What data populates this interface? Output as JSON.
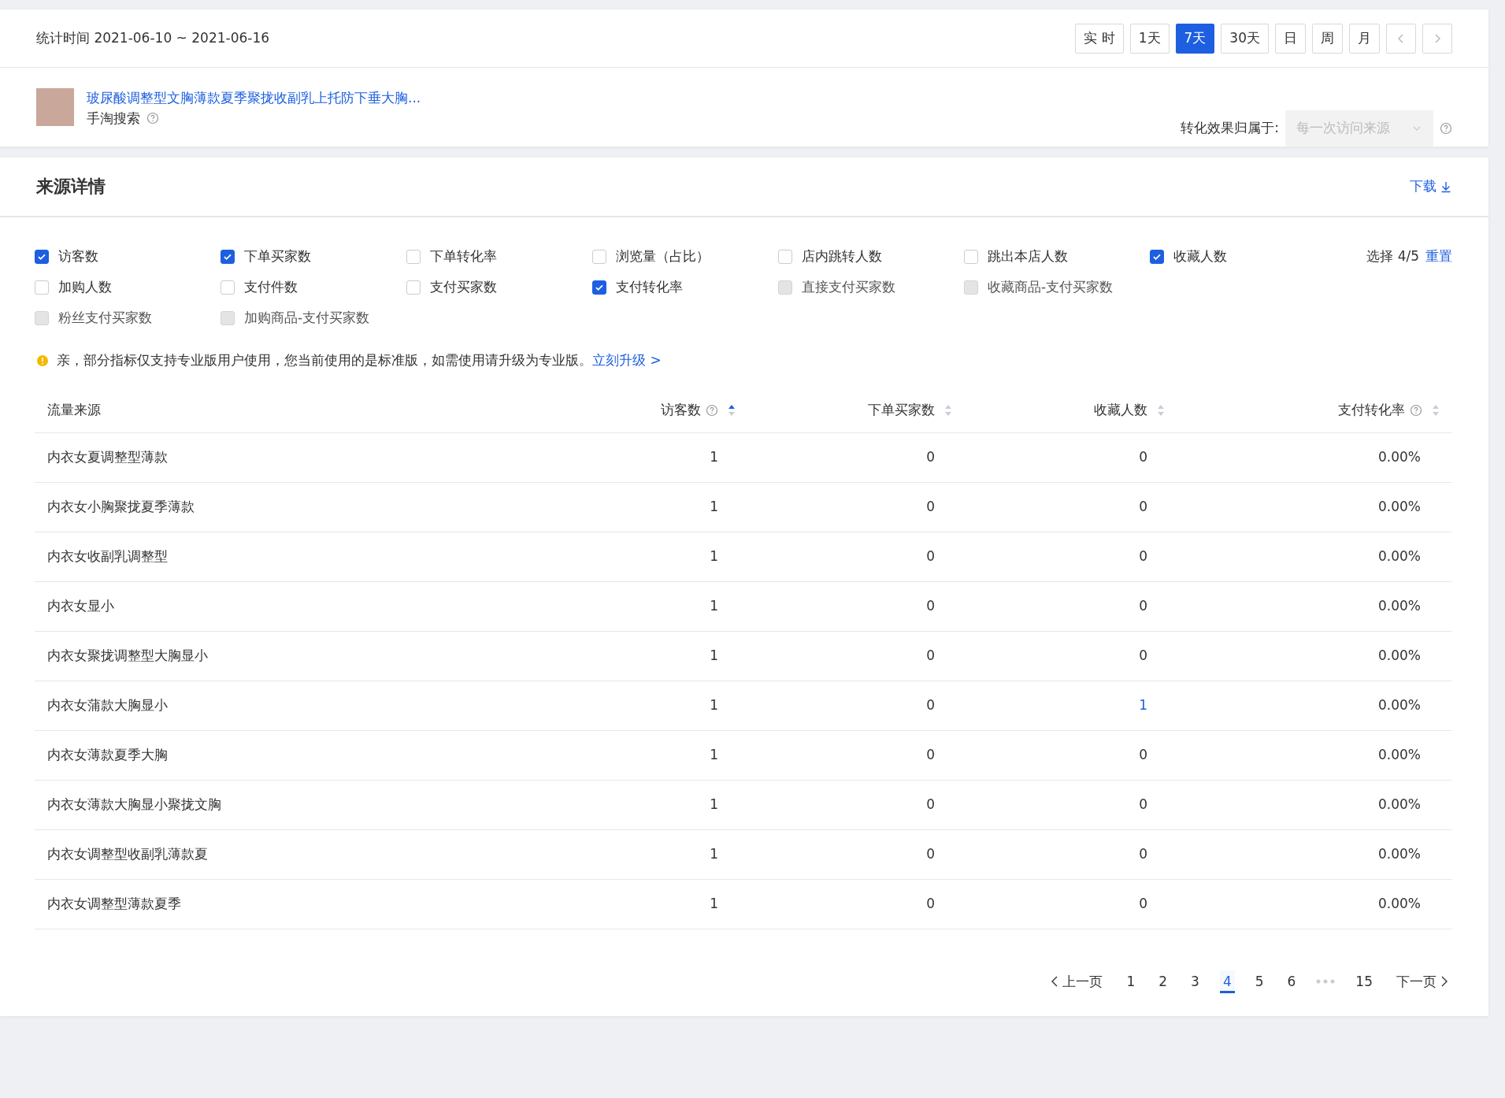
{
  "stats_period": {
    "label": "统计时间 2021-06-10 ~ 2021-06-16"
  },
  "range_buttons": [
    {
      "label": "实 时",
      "selected": false,
      "kind": "text"
    },
    {
      "label": "1天",
      "selected": false,
      "kind": "text"
    },
    {
      "label": "7天",
      "selected": true,
      "kind": "text"
    },
    {
      "label": "30天",
      "selected": false,
      "kind": "text"
    },
    {
      "label": "日",
      "selected": false,
      "kind": "text"
    },
    {
      "label": "周",
      "selected": false,
      "kind": "text"
    },
    {
      "label": "月",
      "selected": false,
      "kind": "text"
    },
    {
      "kind": "prev",
      "selected": false
    },
    {
      "kind": "next",
      "selected": false
    }
  ],
  "product": {
    "title": "玻尿酸调整型文胸薄款夏季聚拢收副乳上托防下垂大胸...",
    "source": "手淘搜索"
  },
  "attribution": {
    "label": "转化效果归属于:",
    "placeholder": "每一次访问来源",
    "disabled": true
  },
  "section": {
    "title": "来源详情",
    "download": "下载"
  },
  "metrics": [
    {
      "label": "访客数",
      "checked": true,
      "disabled": false
    },
    {
      "label": "下单买家数",
      "checked": true,
      "disabled": false
    },
    {
      "label": "下单转化率",
      "checked": false,
      "disabled": false
    },
    {
      "label": "浏览量（占比）",
      "checked": false,
      "disabled": false
    },
    {
      "label": "店内跳转人数",
      "checked": false,
      "disabled": false
    },
    {
      "label": "跳出本店人数",
      "checked": false,
      "disabled": false
    },
    {
      "label": "收藏人数",
      "checked": true,
      "disabled": false
    },
    {
      "label": "加购人数",
      "checked": false,
      "disabled": false
    },
    {
      "label": "支付件数",
      "checked": false,
      "disabled": false
    },
    {
      "label": "支付买家数",
      "checked": false,
      "disabled": false
    },
    {
      "label": "支付转化率",
      "checked": true,
      "disabled": false
    },
    {
      "label": "直接支付买家数",
      "checked": false,
      "disabled": true
    },
    {
      "label": "收藏商品-支付买家数",
      "checked": false,
      "disabled": true
    },
    {
      "label": "粉丝支付买家数",
      "checked": false,
      "disabled": true
    },
    {
      "label": "加购商品-支付买家数",
      "checked": false,
      "disabled": true
    }
  ],
  "selection": {
    "count": "选择 4/5",
    "reset": "重置"
  },
  "notice": {
    "text": "亲，部分指标仅支持专业版用户使用，您当前使用的是标准版，如需使用请升级为专业版。",
    "link": "立刻升级 >"
  },
  "table": {
    "columns": [
      {
        "label": "流量来源",
        "help": false,
        "sortable": false,
        "sorted": false
      },
      {
        "label": "访客数",
        "help": true,
        "sortable": true,
        "sorted": true
      },
      {
        "label": "下单买家数",
        "help": false,
        "sortable": true,
        "sorted": false
      },
      {
        "label": "收藏人数",
        "help": false,
        "sortable": true,
        "sorted": false
      },
      {
        "label": "支付转化率",
        "help": true,
        "sortable": true,
        "sorted": false
      }
    ],
    "rows": [
      {
        "cells": [
          "内衣女夏调整型薄款",
          "1",
          "0",
          "0",
          "0.00%"
        ],
        "linked": [
          false,
          false,
          false,
          false,
          false
        ]
      },
      {
        "cells": [
          "内衣女小胸聚拢夏季薄款",
          "1",
          "0",
          "0",
          "0.00%"
        ],
        "linked": [
          false,
          false,
          false,
          false,
          false
        ]
      },
      {
        "cells": [
          "内衣女收副乳调整型",
          "1",
          "0",
          "0",
          "0.00%"
        ],
        "linked": [
          false,
          false,
          false,
          false,
          false
        ]
      },
      {
        "cells": [
          "内衣女显小",
          "1",
          "0",
          "0",
          "0.00%"
        ],
        "linked": [
          false,
          false,
          false,
          false,
          false
        ]
      },
      {
        "cells": [
          "内衣女聚拢调整型大胸显小",
          "1",
          "0",
          "0",
          "0.00%"
        ],
        "linked": [
          false,
          false,
          false,
          false,
          false
        ]
      },
      {
        "cells": [
          "内衣女蒲款大胸显小",
          "1",
          "0",
          "1",
          "0.00%"
        ],
        "linked": [
          false,
          false,
          false,
          true,
          false
        ]
      },
      {
        "cells": [
          "内衣女薄款夏季大胸",
          "1",
          "0",
          "0",
          "0.00%"
        ],
        "linked": [
          false,
          false,
          false,
          false,
          false
        ]
      },
      {
        "cells": [
          "内衣女薄款大胸显小聚拢文胸",
          "1",
          "0",
          "0",
          "0.00%"
        ],
        "linked": [
          false,
          false,
          false,
          false,
          false
        ]
      },
      {
        "cells": [
          "内衣女调整型收副乳薄款夏",
          "1",
          "0",
          "0",
          "0.00%"
        ],
        "linked": [
          false,
          false,
          false,
          false,
          false
        ]
      },
      {
        "cells": [
          "内衣女调整型薄款夏季",
          "1",
          "0",
          "0",
          "0.00%"
        ],
        "linked": [
          false,
          false,
          false,
          false,
          false
        ]
      }
    ]
  },
  "pagination": {
    "prev": "上一页",
    "next": "下一页",
    "pages": [
      {
        "label": "1",
        "selected": false,
        "kind": "page"
      },
      {
        "label": "2",
        "selected": false,
        "kind": "page"
      },
      {
        "label": "3",
        "selected": false,
        "kind": "page"
      },
      {
        "label": "4",
        "selected": true,
        "kind": "page"
      },
      {
        "label": "5",
        "selected": false,
        "kind": "page"
      },
      {
        "label": "6",
        "selected": false,
        "kind": "page"
      },
      {
        "kind": "ellipsis"
      },
      {
        "label": "15",
        "selected": false,
        "kind": "page"
      }
    ]
  }
}
